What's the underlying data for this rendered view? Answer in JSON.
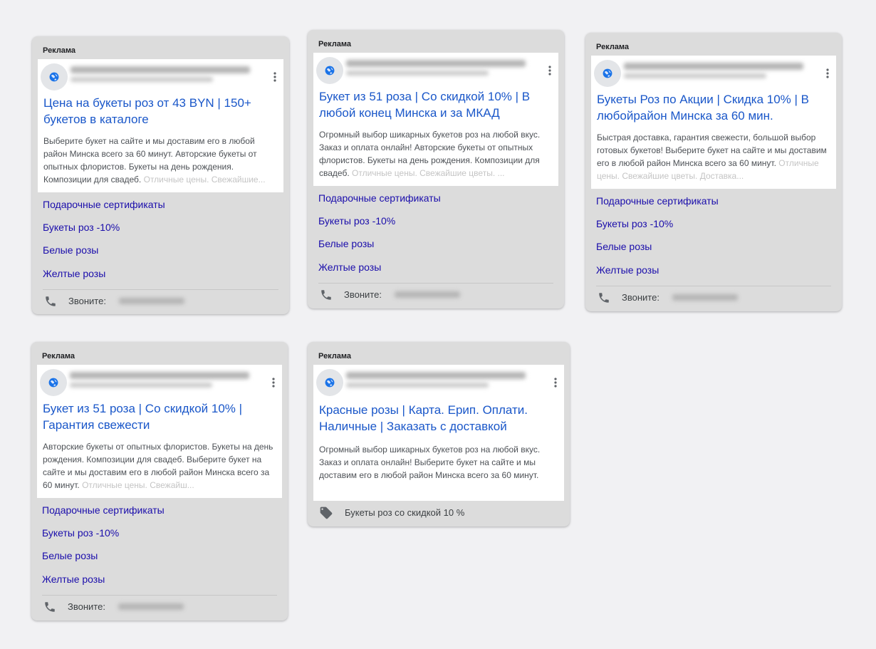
{
  "ads": [
    {
      "label": "Реклама",
      "headline": "Цена на букеты роз от 43 BYN | 150+ букетов в каталоге",
      "description": "Выберите букет на сайте и мы доставим его в любой район Минска всего за 60 минут. Авторские букеты от опытных флористов. Букеты на день рождения. Композиции для свадеб.",
      "description_tail": " Отличные цены. Свежайшие...",
      "sitelinks": [
        "Подарочные сертификаты",
        "Букеты роз -10%",
        "Белые розы",
        "Желтые розы"
      ],
      "call_label": "Звоните: "
    },
    {
      "label": "Реклама",
      "headline": "Букет из 51 роза | Со скидкой 10% | В любой конец Минска и за МКАД",
      "description": "Огромный выбор шикарных букетов роз на любой вкус. Заказ и оплата онлайн! Авторские букеты от опытных флористов. Букеты на день рождения. Композиции для свадеб.",
      "description_tail": " Отличные цены. Свежайшие цветы. ...",
      "sitelinks": [
        "Подарочные сертификаты",
        "Букеты роз -10%",
        "Белые розы",
        "Желтые розы"
      ],
      "call_label": "Звоните: "
    },
    {
      "label": "Реклама",
      "headline": "Букеты Роз по Акции | Скидка 10% | В любойрайон Минска за 60 мин.",
      "description": "Быстрая доставка, гарантия свежести, большой выбор готовых букетов! Выберите букет на сайте и мы доставим его в любой район Минска всего за 60 минут.",
      "description_tail": " Отличные цены. Свежайшие цветы. Доставка...",
      "sitelinks": [
        "Подарочные сертификаты",
        "Букеты роз -10%",
        "Белые розы",
        "Желтые розы"
      ],
      "call_label": "Звоните: "
    },
    {
      "label": "Реклама",
      "headline": "Букет из 51 роза | Со скидкой 10% | Гарантия свежести",
      "description": "Авторские букеты от опытных флористов. Букеты на день рождения. Композиции для свадеб. Выберите букет на сайте и мы доставим его в любой район Минска всего за 60 минут.",
      "description_tail": " Отличные цены. Свежайш...",
      "sitelinks": [
        "Подарочные сертификаты",
        "Букеты роз -10%",
        "Белые розы",
        "Желтые розы"
      ],
      "call_label": "Звоните: "
    },
    {
      "label": "Реклама",
      "headline": "Красные розы | Карта. Ерип. Оплати. Наличные | Заказать с доставкой",
      "description": "Огромный выбор шикарных букетов роз на любой вкус. Заказ и оплата онлайн! Выберите букет на сайте и мы доставим его в любой район Минска всего за 60 минут.",
      "description_tail": "",
      "promotion": "Букеты роз со скидкой 10 %"
    }
  ],
  "icons": {
    "favicon": "globe-icon",
    "menu": "more-vert-icon",
    "call": "phone-icon",
    "promo": "tag-icon"
  },
  "colors": {
    "headline": "#1a57c9",
    "sitelink": "#1a0dab",
    "card": "#dcdcdc",
    "background": "#f1f1f3"
  }
}
